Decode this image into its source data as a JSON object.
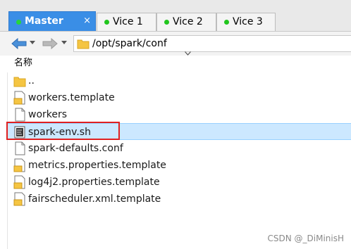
{
  "tabs": [
    {
      "label": "Master",
      "active": true,
      "status_color": "#26d63a"
    },
    {
      "label": "Vice 1",
      "active": false,
      "status_color": "#22c61e"
    },
    {
      "label": "Vice 2",
      "active": false,
      "status_color": "#22c61e"
    },
    {
      "label": "Vice 3",
      "active": false,
      "status_color": "#22c61e"
    }
  ],
  "tab_close_glyph": "×",
  "toolbar": {
    "back_icon": "back-arrow-icon",
    "forward_icon": "forward-arrow-icon",
    "path": "/opt/spark/conf"
  },
  "list": {
    "column_header": "名称",
    "files": [
      {
        "name": "..",
        "icon": "folder-icon",
        "selected": false
      },
      {
        "name": "workers.template",
        "icon": "template-file-icon",
        "selected": false
      },
      {
        "name": "workers",
        "icon": "file-icon",
        "selected": false
      },
      {
        "name": "spark-env.sh",
        "icon": "script-file-icon",
        "selected": true
      },
      {
        "name": "spark-defaults.conf",
        "icon": "file-icon",
        "selected": false
      },
      {
        "name": "metrics.properties.template",
        "icon": "template-file-icon",
        "selected": false
      },
      {
        "name": "log4j2.properties.template",
        "icon": "template-file-icon",
        "selected": false
      },
      {
        "name": "fairscheduler.xml.template",
        "icon": "template-file-icon",
        "selected": false
      }
    ]
  },
  "colors": {
    "active_tab": "#3a8ee6",
    "selection": "#cce8ff",
    "highlight_border": "#e02020",
    "folder": "#f5c542"
  },
  "watermark": "CSDN @_DiMinisH"
}
